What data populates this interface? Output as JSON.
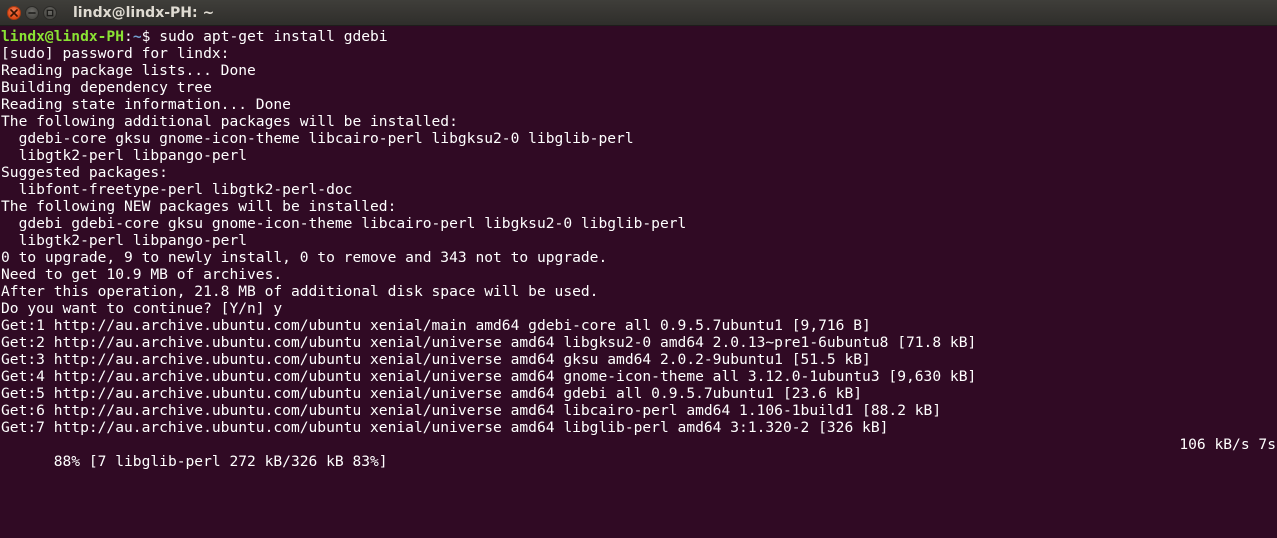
{
  "window": {
    "title": "lindx@lindx-PH: ~",
    "controls": [
      "close-icon",
      "minimize-icon",
      "maximize-icon"
    ]
  },
  "colors": {
    "background": "#300a24",
    "foreground": "#ffffff",
    "prompt_user": "#8ae234",
    "prompt_path": "#729fcf"
  },
  "terminal": {
    "prompt": {
      "user_host": "lindx@lindx-PH",
      "separator": ":",
      "path": "~",
      "symbol": "$ ",
      "command": "sudo apt-get install gdebi"
    },
    "lines": [
      "[sudo] password for lindx:",
      "Reading package lists... Done",
      "Building dependency tree",
      "Reading state information... Done",
      "The following additional packages will be installed:",
      "  gdebi-core gksu gnome-icon-theme libcairo-perl libgksu2-0 libglib-perl",
      "  libgtk2-perl libpango-perl",
      "Suggested packages:",
      "  libfont-freetype-perl libgtk2-perl-doc",
      "The following NEW packages will be installed:",
      "  gdebi gdebi-core gksu gnome-icon-theme libcairo-perl libgksu2-0 libglib-perl",
      "  libgtk2-perl libpango-perl",
      "0 to upgrade, 9 to newly install, 0 to remove and 343 not to upgrade.",
      "Need to get 10.9 MB of archives.",
      "After this operation, 21.8 MB of additional disk space will be used.",
      "Do you want to continue? [Y/n] y",
      "Get:1 http://au.archive.ubuntu.com/ubuntu xenial/main amd64 gdebi-core all 0.9.5.7ubuntu1 [9,716 B]",
      "Get:2 http://au.archive.ubuntu.com/ubuntu xenial/universe amd64 libgksu2-0 amd64 2.0.13~pre1-6ubuntu8 [71.8 kB]",
      "Get:3 http://au.archive.ubuntu.com/ubuntu xenial/universe amd64 gksu amd64 2.0.2-9ubuntu1 [51.5 kB]",
      "Get:4 http://au.archive.ubuntu.com/ubuntu xenial/universe amd64 gnome-icon-theme all 3.12.0-1ubuntu3 [9,630 kB]",
      "Get:5 http://au.archive.ubuntu.com/ubuntu xenial/universe amd64 gdebi all 0.9.5.7ubuntu1 [23.6 kB]",
      "Get:6 http://au.archive.ubuntu.com/ubuntu xenial/universe amd64 libcairo-perl amd64 1.106-1build1 [88.2 kB]",
      "Get:7 http://au.archive.ubuntu.com/ubuntu xenial/universe amd64 libglib-perl amd64 3:1.320-2 [326 kB]"
    ],
    "progress": {
      "status": "88% [7 libglib-perl 272 kB/326 kB 83%]",
      "rate": "106 kB/s 7s"
    }
  }
}
